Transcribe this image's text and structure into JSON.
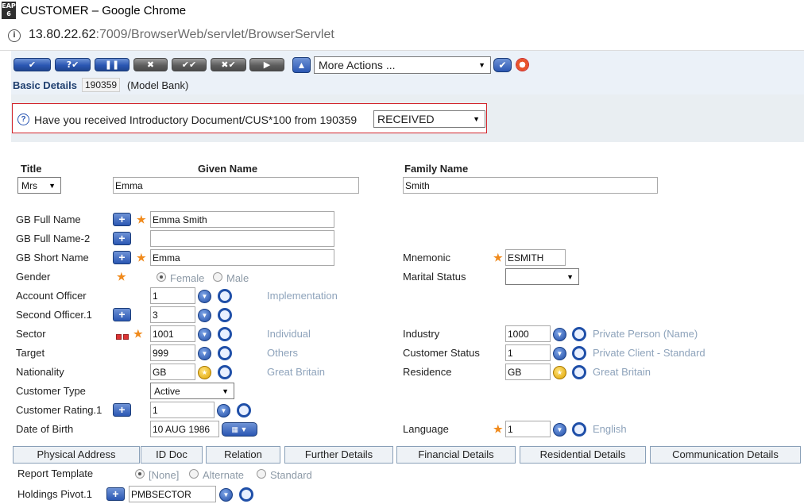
{
  "browser": {
    "window_title": "CUSTOMER – Google Chrome",
    "app_icon_text": "EAP 6",
    "url_host": "13.80.22.62",
    "url_rest": ":7009/BrowserWeb/servlet/BrowserServlet"
  },
  "toolbar": {
    "buttons": [
      "✔",
      "?✔",
      "❚❚",
      "✖",
      "✔✔",
      "✖✔",
      "▶"
    ],
    "up_icon": "arrow-up-icon",
    "more_actions": "More Actions ...",
    "go_icon": "check-icon",
    "help_icon": "lifebuoy-icon"
  },
  "basic": {
    "label": "Basic Details",
    "id": "190359",
    "bank": "(Model Bank)"
  },
  "override": {
    "text": "Have you received Introductory Document/CUS*100 from 190359",
    "value": "RECEIVED"
  },
  "headers": {
    "title": "Title",
    "given": "Given Name",
    "family": "Family Name"
  },
  "name": {
    "title": "Mrs",
    "given": "Emma",
    "family": "Smith"
  },
  "labels": {
    "gb_full_name": "GB Full Name",
    "gb_full_name2": "GB Full Name-2",
    "gb_short_name": "GB Short Name",
    "gender": "Gender",
    "account_officer": "Account Officer",
    "second_officer": "Second Officer.1",
    "sector": "Sector",
    "target": "Target",
    "nationality": "Nationality",
    "customer_type": "Customer Type",
    "customer_rating": "Customer Rating.1",
    "date_of_birth": "Date of Birth",
    "mnemonic": "Mnemonic",
    "marital_status": "Marital Status",
    "industry": "Industry",
    "customer_status": "Customer Status",
    "residence": "Residence",
    "language": "Language",
    "report_template": "Report Template",
    "holdings_pivot": "Holdings Pivot.1"
  },
  "values": {
    "gb_full_name": "Emma Smith",
    "gb_full_name2": "",
    "gb_short_name": "Emma",
    "gender_female": "Female",
    "gender_male": "Male",
    "account_officer": "1",
    "second_officer": "3",
    "sector": "1001",
    "target": "999",
    "nationality": "GB",
    "customer_type": "Active",
    "customer_rating": "1",
    "date_of_birth": "10 AUG 1986",
    "mnemonic": "ESMITH",
    "marital_status": "",
    "industry": "1000",
    "customer_status": "1",
    "residence": "GB",
    "language": "1",
    "holdings_pivot": "PMBSECTOR",
    "report_none": "[None]",
    "report_alternate": "Alternate",
    "report_standard": "Standard"
  },
  "enrichments": {
    "account_officer": "Implementation",
    "sector": "Individual",
    "target": "Others",
    "nationality": "Great Britain",
    "industry": "Private Person (Name)",
    "customer_status": "Private Client - Standard",
    "residence": "Great Britain",
    "language": "English"
  },
  "tabs": [
    "Physical Address",
    "ID Doc",
    "Relation",
    "Further Details",
    "Financial Details",
    "Residential Details",
    "Communication Details"
  ],
  "colors": {
    "accent": "#2b57b3",
    "mandatory": "#f08a1c",
    "enrichment": "#8ea3bb",
    "alert_border": "#d2232a"
  }
}
